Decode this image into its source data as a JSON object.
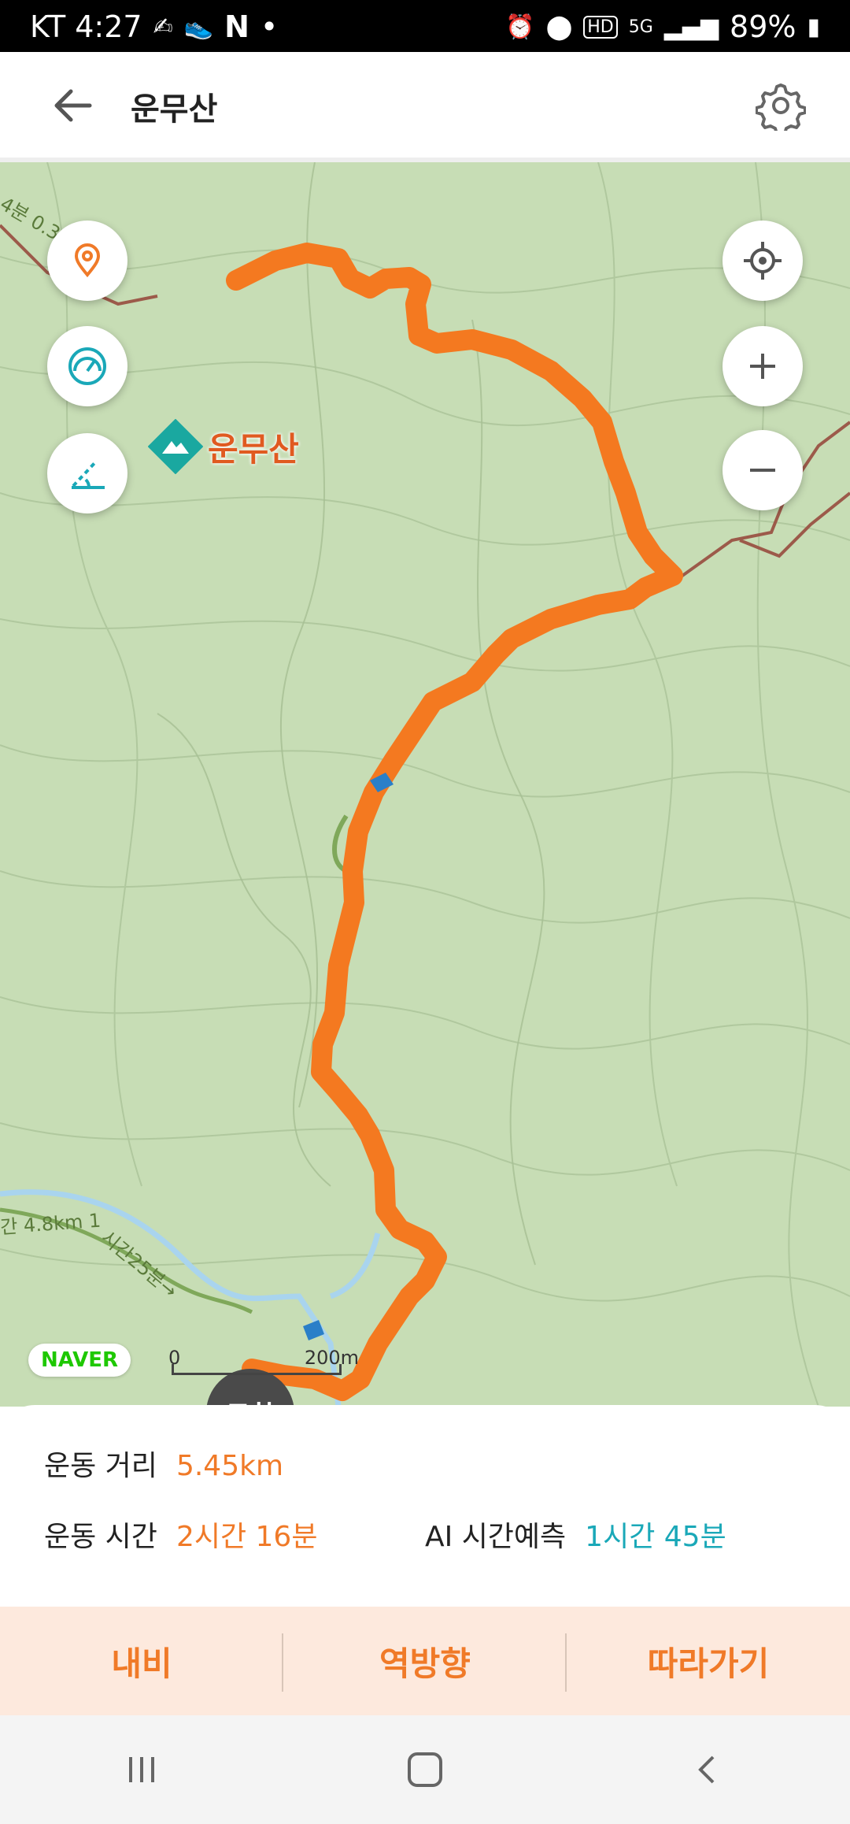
{
  "status_bar": {
    "carrier_time": "KT 4:27",
    "notification_n": "N",
    "dot": "•",
    "hd": "HD",
    "network": "5G",
    "battery": "89%"
  },
  "app_bar": {
    "title": "운무산",
    "back_icon": "arrow-left-icon",
    "settings_icon": "gear-icon"
  },
  "map": {
    "summit_label": "운무산",
    "trail_labels": [
      "4분 0.3",
      "간 4.8km 1",
      "시간25분→"
    ],
    "arrival_label": "도착",
    "provider_logo": "NAVER",
    "scale": {
      "min": "0",
      "max": "200m"
    },
    "route_color": "#f47920",
    "buttons": [
      "location-pin-icon",
      "speedometer-icon",
      "slope-icon",
      "my-location-icon",
      "zoom-in-icon",
      "zoom-out-icon"
    ]
  },
  "summary": {
    "distance_label": "운동 거리",
    "distance_value": "5.45km",
    "time_label": "운동 시간",
    "time_value": "2시간 16분",
    "ai_label": "AI 시간예측",
    "ai_value": "1시간 45분"
  },
  "actions": {
    "navi": "내비",
    "reverse": "역방향",
    "follow": "따라가기"
  },
  "colors": {
    "accent": "#f07a28",
    "teal": "#1aa8b8"
  }
}
